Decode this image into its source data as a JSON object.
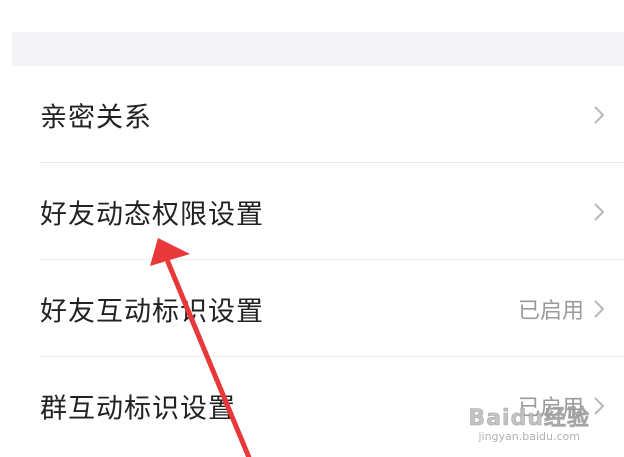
{
  "settings": {
    "items": [
      {
        "label": "亲密关系",
        "status": ""
      },
      {
        "label": "好友动态权限设置",
        "status": ""
      },
      {
        "label": "好友互动标识设置",
        "status": "已启用"
      },
      {
        "label": "群互动标识设置",
        "status": "已启用"
      }
    ]
  },
  "watermark": {
    "main": "Baidu经验",
    "sub": "jingyan.baidu.com"
  },
  "colors": {
    "arrow": "#e8383a",
    "section_gap": "#f4f4f6",
    "label_text": "#222222",
    "status_text": "#9b9b9b"
  }
}
